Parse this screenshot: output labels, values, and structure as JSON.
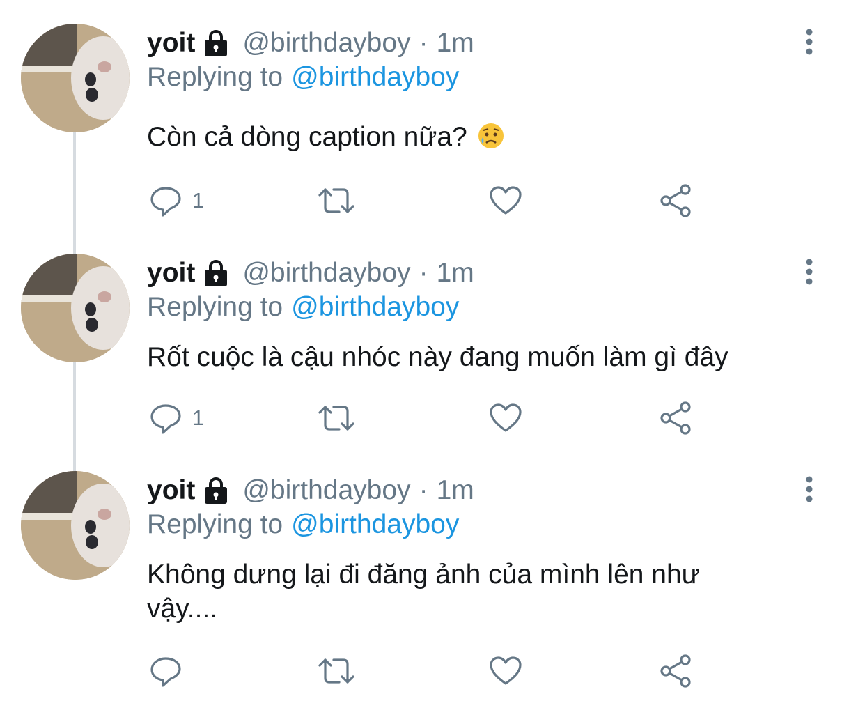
{
  "colors": {
    "text": "#14171a",
    "secondary": "#657786",
    "link": "#1b95e0",
    "thread_line": "#d6dbe0"
  },
  "tweets": [
    {
      "name": "yoit",
      "handle": "@birthdayboy",
      "separator": "·",
      "time": "1m",
      "replying_label": "Replying to",
      "replying_handle": "@birthdayboy",
      "text": "Còn cả dòng caption nữa?",
      "emoji": "sad-relieved-face-emoji",
      "reply_count": "1"
    },
    {
      "name": "yoit",
      "handle": "@birthdayboy",
      "separator": "·",
      "time": "1m",
      "replying_label": "Replying to",
      "replying_handle": "@birthdayboy",
      "text": "Rốt cuộc là cậu nhóc này đang muốn làm gì đây",
      "reply_count": "1"
    },
    {
      "name": "yoit",
      "handle": "@birthdayboy",
      "separator": "·",
      "time": "1m",
      "replying_label": "Replying to",
      "replying_handle": "@birthdayboy",
      "text": "Không dưng lại đi đăng ảnh của mình lên như vậy....",
      "reply_count": ""
    }
  ],
  "icons": {
    "lock": "lock-icon",
    "more": "more-vertical-icon",
    "reply": "reply-icon",
    "retweet": "retweet-icon",
    "like": "heart-icon",
    "share": "share-icon"
  }
}
